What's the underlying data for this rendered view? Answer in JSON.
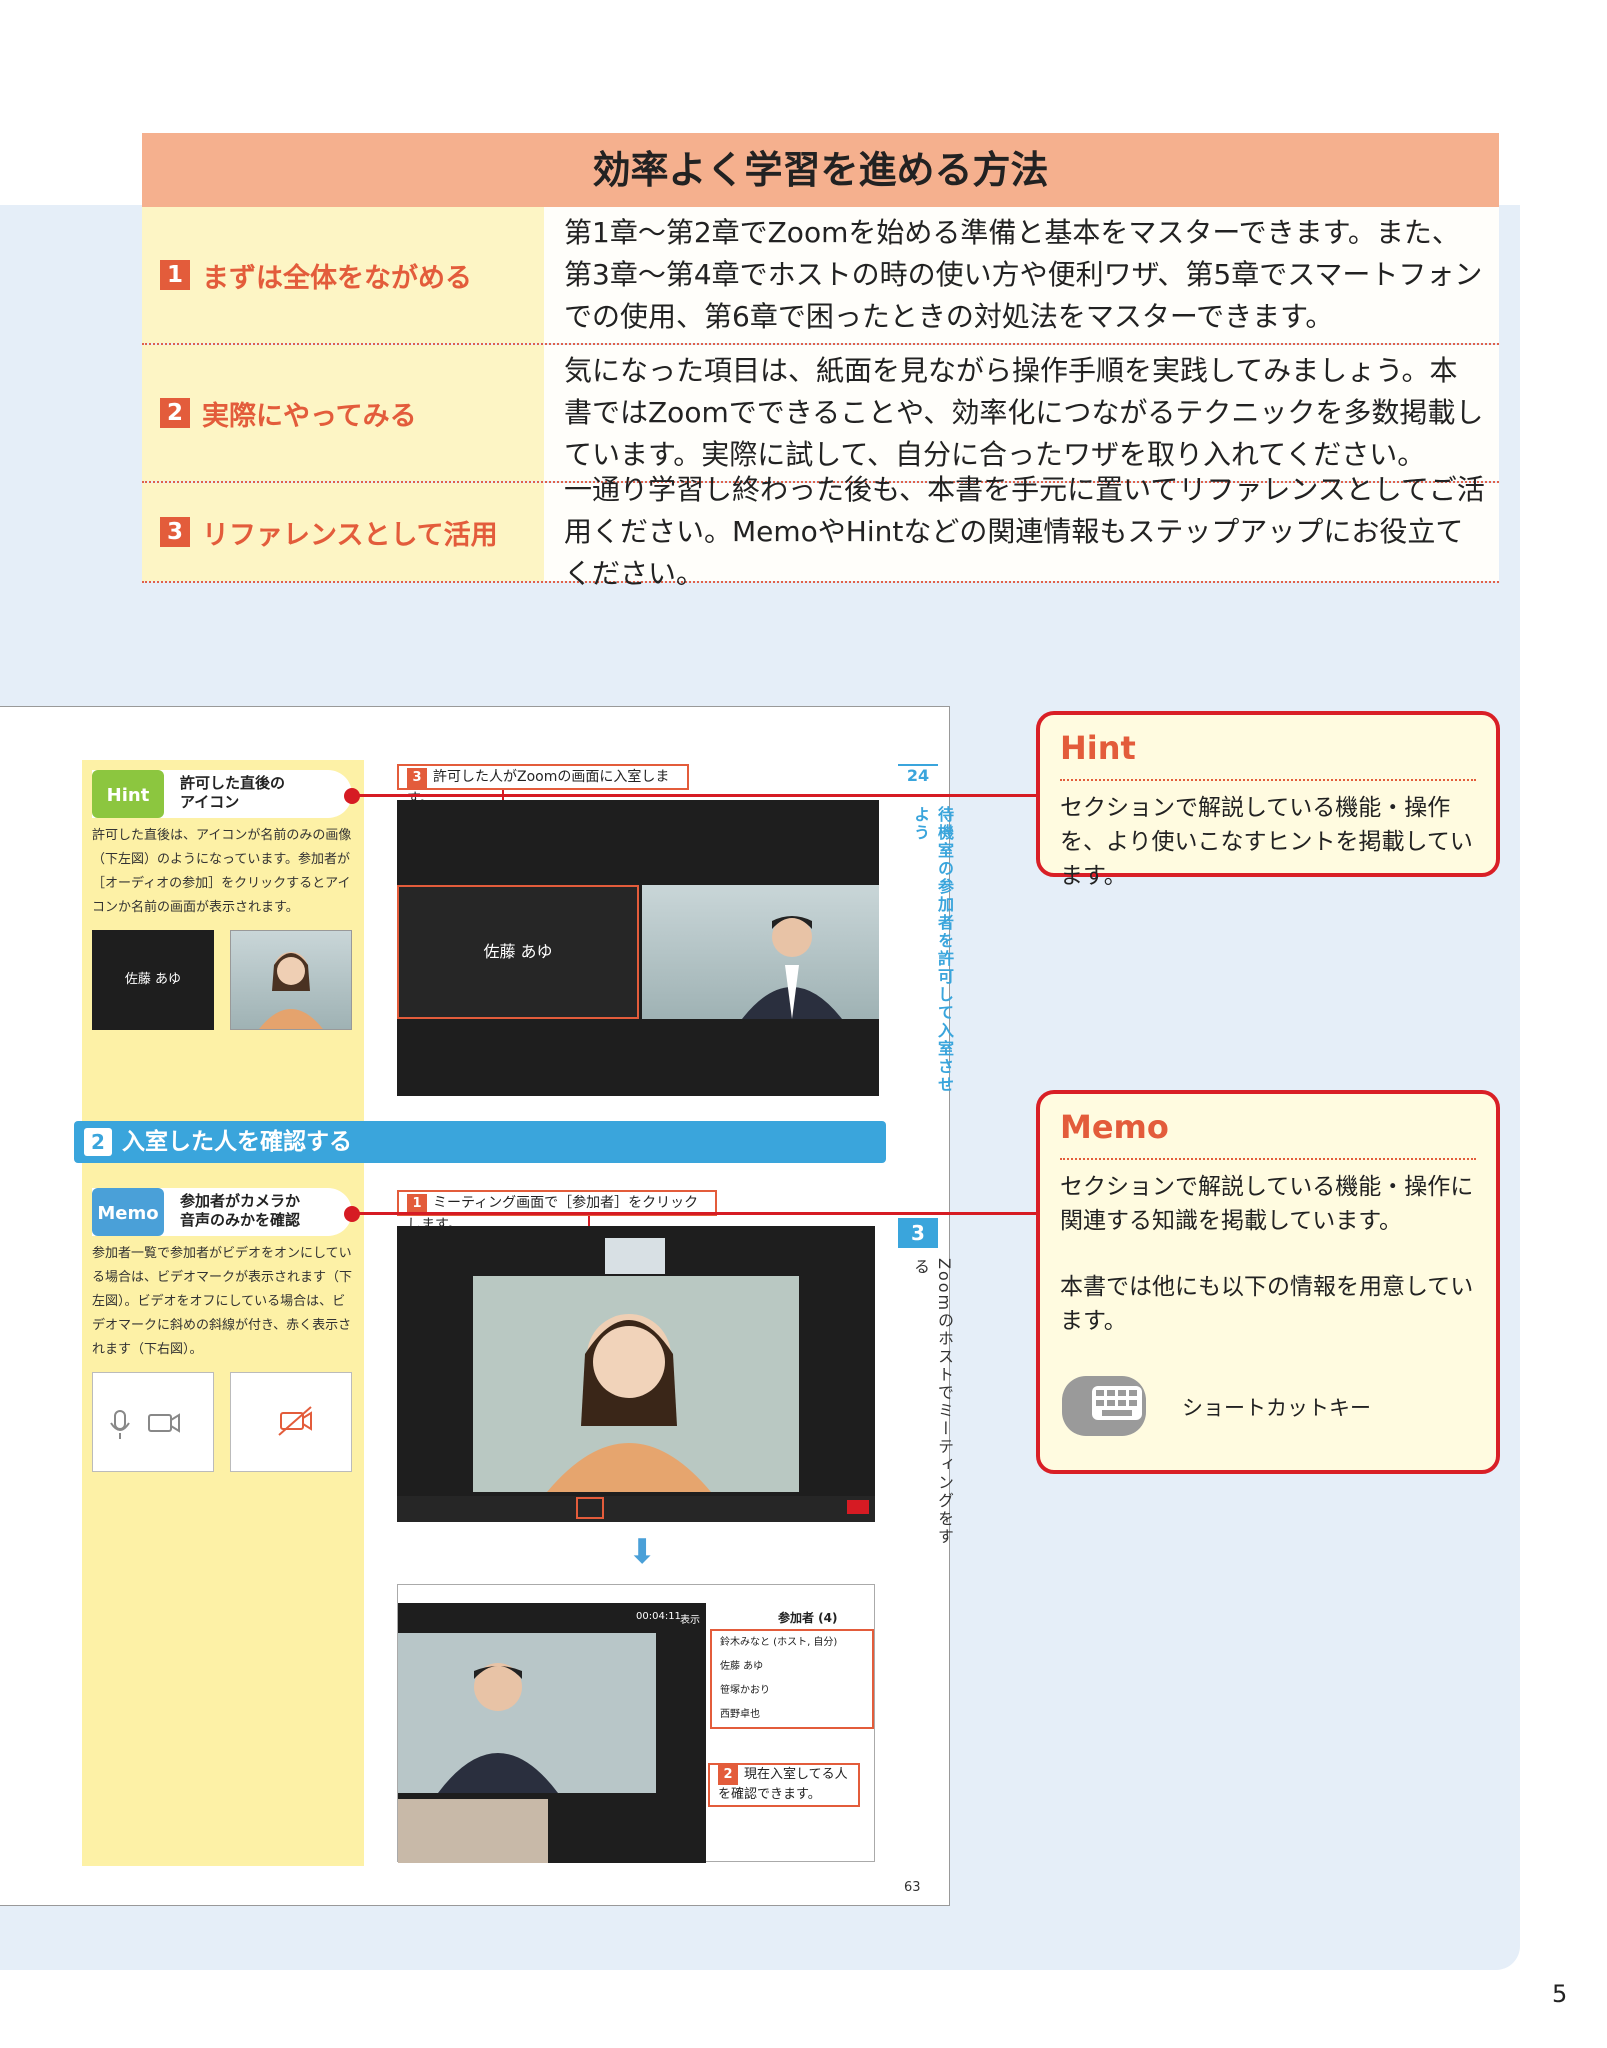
{
  "intro": {
    "title": "効率よく学習を進める方法",
    "rows": [
      {
        "num": "1",
        "label": "まずは全体をながめる",
        "text": "第1章～第2章でZoomを始める準備と基本をマスターできます。また、第3章～第4章でホストの時の使い方や便利ワザ、第5章でスマートフォンでの使用、第6章で困ったときの対処法をマスターできます。"
      },
      {
        "num": "2",
        "label": "実際にやってみる",
        "text": "気になった項目は、紙面を見ながら操作手順を実践してみましょう。本書ではZoomでできることや、効率化につながるテクニックを多数掲載しています。実際に試して、自分に合ったワザを取り入れてください。"
      },
      {
        "num": "3",
        "label": "リファレンスとして活用",
        "text": "一通り学習し終わった後も、本書を手元に置いてリファレンスとしてご活用ください。MemoやHintなどの関連情報もステップアップにお役立てください。"
      }
    ]
  },
  "sample_page": {
    "hint_badge": "Hint",
    "hint_title_1": "許可した直後の",
    "hint_title_2": "アイコン",
    "hint_body": "許可した直後は、アイコンが名前のみの画像（下左図）のようになっています。参加者が［オーディオの参加］をクリックするとアイコンか名前の画面が表示されます。",
    "hint_thumb_name": "佐藤 あゆ",
    "step3_num": "3",
    "step3_text": "許可した人がZoomの画面に入室します。",
    "screen1_name": "佐藤 あゆ",
    "section_num": "2",
    "section_title": "入室した人を確認する",
    "memo_badge": "Memo",
    "memo_title_1": "参加者がカメラか",
    "memo_title_2": "音声のみかを確認",
    "memo_body": "参加者一覧で参加者がビデオをオンにしている場合は、ビデオマークが表示されます（下左図）。ビデオをオフにしている場合は、ビデオマークに斜めの斜線が付き、赤く表示されます（下右図）。",
    "step1_num": "1",
    "step1_text": "ミーティング画面で［参加者］をクリックします。",
    "participants_title": "参加者 (4)",
    "timer": "00:04:11",
    "view_label": "表示",
    "participants": [
      "鈴木みなと (ホスト, 自分)",
      "佐藤 あゆ",
      "笹塚かおり",
      "西野卓也"
    ],
    "step2_num": "2",
    "step2_text_1": "現在入室してる人",
    "step2_text_2": "を確認できます。",
    "page_number": "63",
    "side_number_1": "24",
    "side_text_1": "待機室の参加者を許可して入室させよう",
    "side_number_2": "3",
    "side_text_2": "Zoomのホストでミーティングをする"
  },
  "hint_box": {
    "heading": "Hint",
    "body": "セクションで解説している機能・操作を、より使いこなすヒントを掲載しています。"
  },
  "memo_box": {
    "heading": "Memo",
    "body_1": "セクションで解説している機能・操作に関連する知識を掲載しています。",
    "body_2": "本書では他にも以下の情報を用意しています。",
    "shortcut_label": "ショートカットキー"
  },
  "page_number": "5",
  "colors": {
    "accent_red": "#e35c3b",
    "border_red": "#d91f26",
    "title_bg": "#f5b08e",
    "label_bg": "#fdf5c5",
    "section_blue": "#3aa5dc",
    "hint_green": "#8cc63f"
  }
}
